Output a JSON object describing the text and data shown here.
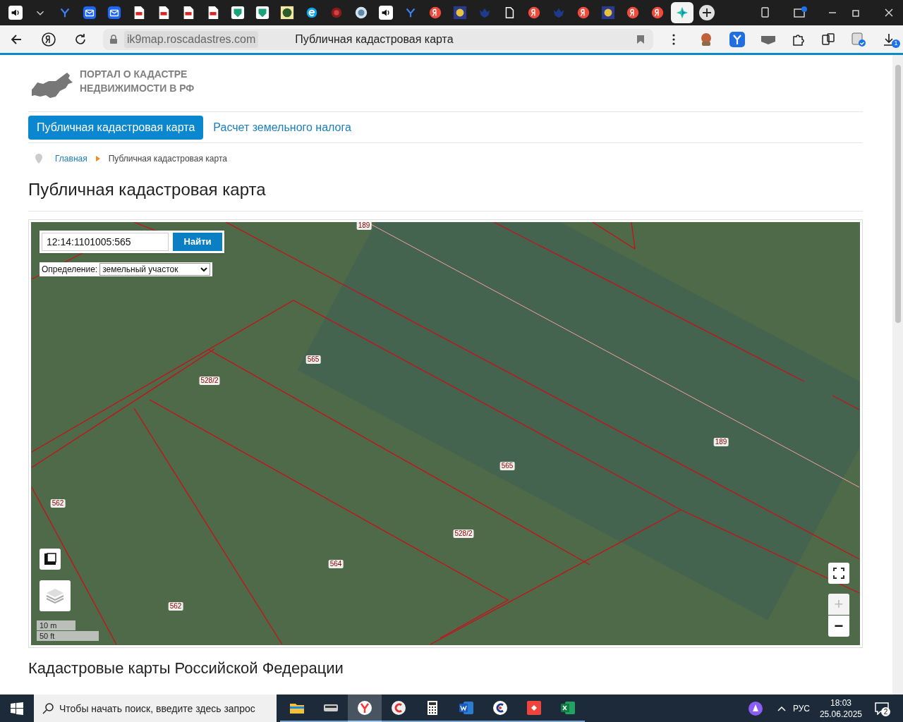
{
  "browser": {
    "tabs": [
      {
        "kind": "speaker",
        "selected": false
      },
      {
        "kind": "chevron",
        "selected": false
      },
      {
        "kind": "y",
        "selected": false
      },
      {
        "kind": "mail",
        "selected": false
      },
      {
        "kind": "mail",
        "selected": false
      },
      {
        "kind": "pdf",
        "selected": false
      },
      {
        "kind": "pdf",
        "selected": false
      },
      {
        "kind": "pdf",
        "selected": false
      },
      {
        "kind": "pdf",
        "selected": false
      },
      {
        "kind": "shield",
        "selected": false
      },
      {
        "kind": "shield",
        "selected": false
      },
      {
        "kind": "emblem",
        "selected": false
      },
      {
        "kind": "e",
        "selected": false
      },
      {
        "kind": "ornament",
        "selected": false
      },
      {
        "kind": "globe",
        "selected": false
      },
      {
        "kind": "speaker",
        "selected": false
      },
      {
        "kind": "y",
        "selected": false
      },
      {
        "kind": "ya",
        "selected": false
      },
      {
        "kind": "crest",
        "selected": false
      },
      {
        "kind": "eagle",
        "selected": false
      },
      {
        "kind": "doc",
        "selected": false
      },
      {
        "kind": "ya",
        "selected": false
      },
      {
        "kind": "eagle",
        "selected": false
      },
      {
        "kind": "ya",
        "selected": false
      },
      {
        "kind": "crest",
        "selected": false
      },
      {
        "kind": "ya",
        "selected": false
      },
      {
        "kind": "ya",
        "selected": false
      },
      {
        "kind": "star",
        "selected": true
      }
    ],
    "url": "ik9map.roscadastres.com",
    "page_title": "Публичная кадастровая карта",
    "downloads_badge": "1"
  },
  "logo": {
    "lines": [
      "ПОРТАЛ О КАДАСТРЕ",
      "НЕДВИЖИМОСТИ В РФ"
    ]
  },
  "nav": [
    {
      "label": "Публичная кадастровая карта",
      "selected": true
    },
    {
      "label": "Расчет земельного налога",
      "selected": false
    }
  ],
  "breadcrumb": [
    "Главная",
    "Публичная кадастровая карта"
  ],
  "heading": "Публичная кадастровая карта",
  "map": {
    "search_value": "12:14:1101005:565",
    "search_button": "Найти",
    "definition_label": "Определение:",
    "definition_value": "земельный участок",
    "parcel_labels": [
      "189",
      "565",
      "528/2",
      "565",
      "189",
      "562",
      "528/2",
      "564",
      "562"
    ],
    "zoom_in": "+",
    "zoom_out": "−",
    "scale": [
      "10 m",
      "50 ft"
    ]
  },
  "section_heading": "Кадастровые карты Российской Федерации",
  "taskbar": {
    "search_placeholder": "Чтобы начать поиск, введите здесь запрос",
    "apps": [
      {
        "kind": "folder",
        "active": false
      },
      {
        "kind": "scanner",
        "active": false
      },
      {
        "kind": "yandex",
        "active": true
      },
      {
        "kind": "ring-c",
        "active": false
      },
      {
        "kind": "calculator",
        "active": false
      },
      {
        "kind": "word",
        "active": false
      },
      {
        "kind": "c",
        "active": false
      },
      {
        "kind": "anydesk",
        "active": false
      },
      {
        "kind": "excel",
        "active": false
      }
    ],
    "language": "РУС",
    "time": "18:03",
    "date": "25.06.2025",
    "notifications": "2"
  }
}
